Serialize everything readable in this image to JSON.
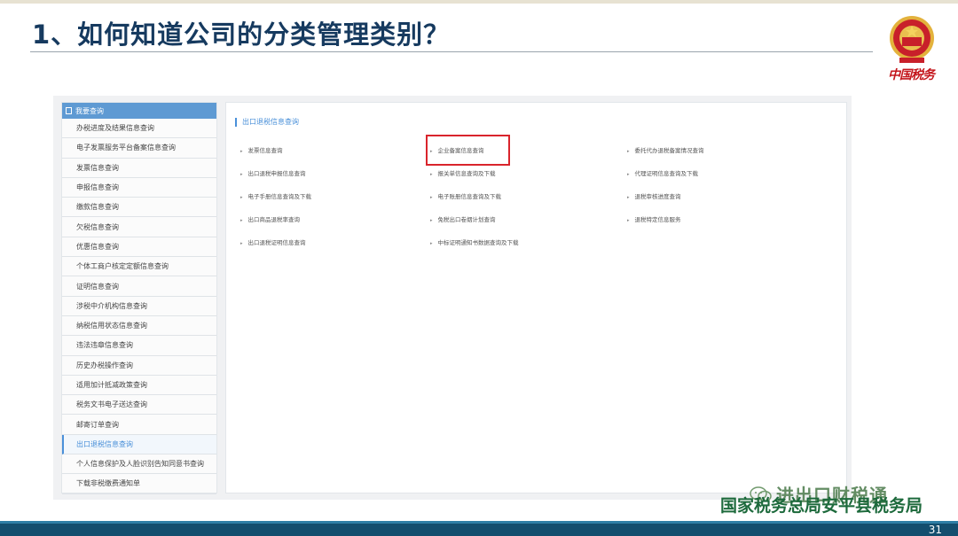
{
  "slide": {
    "title": "1、如何知道公司的分类管理类别？",
    "brand_logo_text": "中国税务",
    "footer_org": "国家税务总局安平县税务局",
    "watermark_text": "进出口财税通",
    "page_number": "31"
  },
  "sidebar": {
    "header": "我要查询",
    "items": [
      {
        "label": "办税进度及结果信息查询"
      },
      {
        "label": "电子发票服务平台备案信息查询"
      },
      {
        "label": "发票信息查询"
      },
      {
        "label": "申报信息查询"
      },
      {
        "label": "缴款信息查询"
      },
      {
        "label": "欠税信息查询"
      },
      {
        "label": "优惠信息查询"
      },
      {
        "label": "个体工商户核定定额信息查询"
      },
      {
        "label": "证明信息查询"
      },
      {
        "label": "涉税中介机构信息查询"
      },
      {
        "label": "纳税信用状态信息查询"
      },
      {
        "label": "违法违章信息查询"
      },
      {
        "label": "历史办税操作查询"
      },
      {
        "label": "适用加计抵减政策查询"
      },
      {
        "label": "税务文书电子送达查询"
      },
      {
        "label": "邮寄订单查询"
      },
      {
        "label": "出口退税信息查询",
        "active": true
      },
      {
        "label": "个人信息保护及人脸识别告知同意书查询"
      },
      {
        "label": "下载非税缴费通知单"
      }
    ]
  },
  "content": {
    "section_title": "出口退税信息查询",
    "links": {
      "col1": [
        "发票信息查询",
        "出口退税申报信息查询",
        "电子手册信息查询及下载",
        "出口商品退税率查询",
        "出口退税证明信息查询"
      ],
      "col2": [
        "企业备案信息查询",
        "报关单信息查询及下载",
        "电子账册信息查询及下载",
        "免税出口卷烟计划查询",
        "中标证明通知书数据查询及下载"
      ],
      "col3": [
        "委托代办退税备案情况查询",
        "代理证明信息查询及下载",
        "退税审核进度查询",
        "退税特定信息服务"
      ]
    },
    "highlighted": "企业备案信息查询"
  },
  "colors": {
    "title": "#163a5f",
    "accent_blue": "#4a90d9",
    "highlight_red": "#d9242c",
    "footer_green": "#1d6a3c",
    "bottom_bar": "#144e6e"
  }
}
